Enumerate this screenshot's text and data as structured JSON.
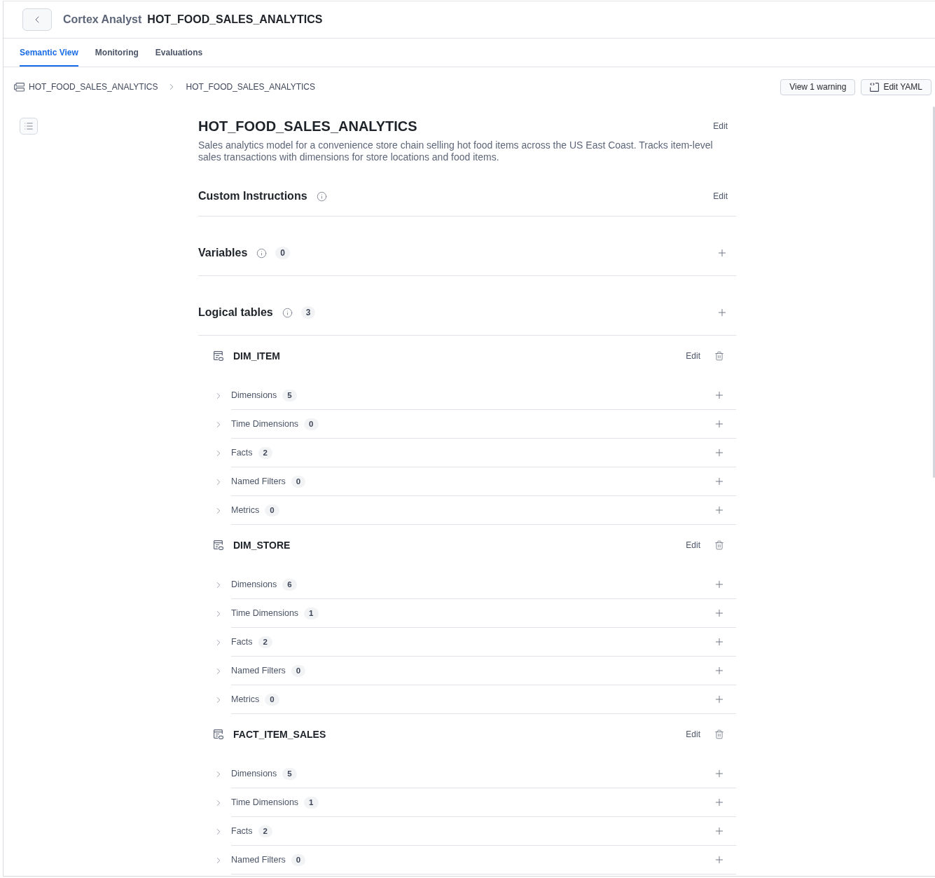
{
  "header": {
    "product": "Cortex Analyst",
    "title": "HOT_FOOD_SALES_ANALYTICS"
  },
  "tabs": [
    {
      "label": "Semantic View",
      "selected": true
    },
    {
      "label": "Monitoring",
      "selected": false
    },
    {
      "label": "Evaluations",
      "selected": false
    }
  ],
  "breadcrumb": [
    "HOT_FOOD_SALES_ANALYTICS",
    "HOT_FOOD_SALES_ANALYTICS"
  ],
  "toolbar_buttons": [
    {
      "label": "View 1 warning",
      "kind": "text"
    },
    {
      "label": "Edit YAML",
      "kind": "code"
    }
  ],
  "model": {
    "title": "HOT_FOOD_SALES_ANALYTICS",
    "action": "Edit",
    "description": "Sales analytics model for a convenience store chain selling hot food items across the US East Coast. Tracks item-level sales transactions with dimensions for store locations and food items."
  },
  "sections": [
    {
      "kind": "editable",
      "title": "Custom Instructions",
      "action": "Edit"
    },
    {
      "kind": "collection",
      "title": "Variables",
      "count": "0"
    },
    {
      "kind": "collection",
      "title": "Logical tables",
      "count": "3",
      "tables": [
        {
          "name": "DIM_ITEM",
          "action": "Edit",
          "groups": [
            {
              "label": "Dimensions",
              "count": "5",
              "expanded": false
            },
            {
              "label": "Time Dimensions",
              "count": "0",
              "expanded": false
            },
            {
              "label": "Facts",
              "count": "2",
              "expanded": false
            },
            {
              "label": "Named Filters",
              "count": "0",
              "expanded": false
            },
            {
              "label": "Metrics",
              "count": "0",
              "expanded": false
            }
          ]
        },
        {
          "name": "DIM_STORE",
          "action": "Edit",
          "groups": [
            {
              "label": "Dimensions",
              "count": "6",
              "expanded": false
            },
            {
              "label": "Time Dimensions",
              "count": "1",
              "expanded": false
            },
            {
              "label": "Facts",
              "count": "2",
              "expanded": false
            },
            {
              "label": "Named Filters",
              "count": "0",
              "expanded": false
            },
            {
              "label": "Metrics",
              "count": "0",
              "expanded": false
            }
          ]
        },
        {
          "name": "FACT_ITEM_SALES",
          "action": "Edit",
          "groups": [
            {
              "label": "Dimensions",
              "count": "5",
              "expanded": false
            },
            {
              "label": "Time Dimensions",
              "count": "1",
              "expanded": false
            },
            {
              "label": "Facts",
              "count": "2",
              "expanded": false
            },
            {
              "label": "Named Filters",
              "count": "0",
              "expanded": false
            }
          ]
        }
      ]
    }
  ]
}
